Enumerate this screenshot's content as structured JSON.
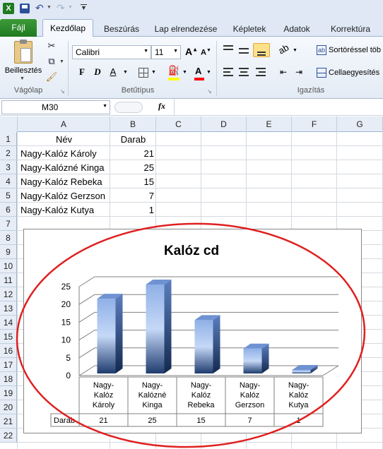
{
  "qat": {
    "icons": [
      "excel-icon",
      "save-icon",
      "undo-icon",
      "redo-icon",
      "customize-icon"
    ]
  },
  "tabs": {
    "file": "Fájl",
    "home": "Kezdőlap",
    "insert": "Beszúrás",
    "layout": "Lap elrendezése",
    "formulas": "Képletek",
    "data": "Adatok",
    "review": "Korrektúra"
  },
  "ribbon": {
    "clipboard": {
      "paste": "Beillesztés",
      "label": "Vágólap"
    },
    "font": {
      "name": "Calibri",
      "size": "11",
      "label": "Betűtípus",
      "bold": "F",
      "italic": "D",
      "underline": "A"
    },
    "alignment": {
      "label": "Igazítás",
      "wrap": "Sortöréssel töb",
      "merge": "Cellaegyesítés"
    },
    "colors": {
      "fill": "#ffff00",
      "font": "#ff0000",
      "accent": "#1f7a20"
    }
  },
  "formula_bar": {
    "name_box": "M30",
    "fx": "fx",
    "formula": ""
  },
  "columns": [
    "A",
    "B",
    "C",
    "D",
    "E",
    "F",
    "G"
  ],
  "rows": [
    "1",
    "2",
    "3",
    "4",
    "5",
    "6",
    "7",
    "8",
    "9",
    "10",
    "11",
    "12",
    "13",
    "14",
    "15",
    "16",
    "17",
    "18",
    "19",
    "20",
    "21",
    "22"
  ],
  "table": {
    "headers": [
      "Név",
      "Darab"
    ],
    "rows": [
      {
        "name": "Nagy-Kalóz Károly",
        "value": "21"
      },
      {
        "name": "Nagy-Kalózné Kinga",
        "value": "25"
      },
      {
        "name": "Nagy-Kalóz Rebeka",
        "value": "15"
      },
      {
        "name": "Nagy-Kalóz Gerzson",
        "value": "7"
      },
      {
        "name": "Nagy-Kalóz Kutya",
        "value": "1"
      }
    ]
  },
  "chart_data": {
    "type": "bar",
    "title": "Kalóz cd",
    "categories": [
      "Nagy-Kalóz Károly",
      "Nagy-Kalózné Kinga",
      "Nagy-Kalóz Rebeka",
      "Nagy-Kalóz Gerzson",
      "Nagy-Kalóz Kutya"
    ],
    "category_lines": [
      [
        "Nagy-",
        "Kalóz",
        "Károly"
      ],
      [
        "Nagy-",
        "Kalózné",
        "Kinga"
      ],
      [
        "Nagy-",
        "Kalóz",
        "Rebeka"
      ],
      [
        "Nagy-",
        "Kalóz",
        "Gerzson"
      ],
      [
        "Nagy-",
        "Kalóz",
        "Kutya"
      ]
    ],
    "series": [
      {
        "name": "Darab",
        "values": [
          21,
          25,
          15,
          7,
          1
        ]
      }
    ],
    "ylim": [
      0,
      25
    ],
    "yticks": [
      "0",
      "5",
      "10",
      "15",
      "20",
      "25"
    ],
    "grid": true,
    "data_table": true,
    "bar_color": "#8fb0e6",
    "annotation_color": "#e02020"
  }
}
